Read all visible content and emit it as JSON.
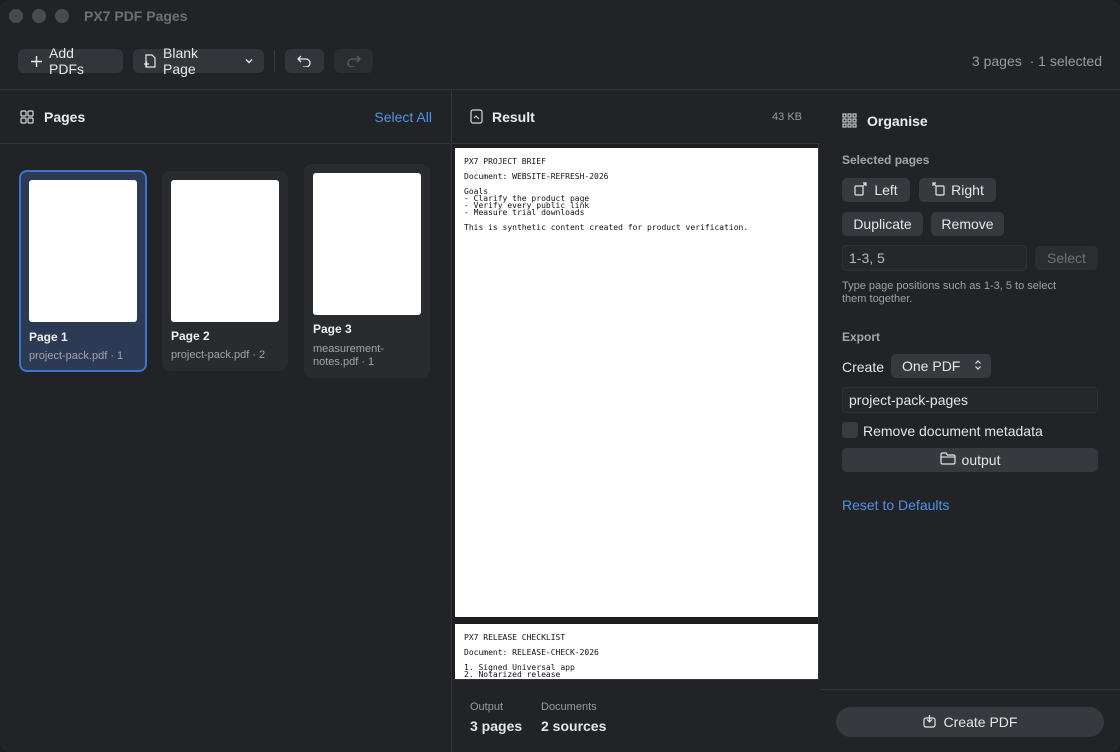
{
  "window": {
    "title": "PX7 PDF Pages"
  },
  "toolbar": {
    "add_pdfs": "Add PDFs",
    "blank_page": "Blank Page",
    "page_count": "3 pages",
    "selected_count": "· 1 selected"
  },
  "pages_panel": {
    "title": "Pages",
    "select_all": "Select All",
    "items": [
      {
        "label": "Page 1",
        "source": "project-pack.pdf · 1",
        "selected": true
      },
      {
        "label": "Page 2",
        "source": "project-pack.pdf · 2",
        "selected": false
      },
      {
        "label": "Page 3",
        "source_line1": "measurement-",
        "source_line2": "notes.pdf · 1",
        "selected": false
      }
    ]
  },
  "result_panel": {
    "title": "Result",
    "size": "43 KB",
    "doc1": {
      "title": "PX7 PROJECT BRIEF",
      "document": "Document: WEBSITE-REFRESH-2026",
      "goals_heading": "Goals",
      "goals": [
        "- Clarify the product page",
        "- Verify every public link",
        "- Measure trial downloads"
      ],
      "note": "This is synthetic content created for product verification."
    },
    "doc2": {
      "title": "PX7 RELEASE CHECKLIST",
      "document": "Document: RELEASE-CHECK-2026",
      "items": [
        "1. Signed Universal app",
        "2. Notarized release"
      ]
    },
    "footer": {
      "output_label": "Output",
      "output_value": "3 pages",
      "documents_label": "Documents",
      "documents_value": "2 sources"
    }
  },
  "organise_panel": {
    "title": "Organise",
    "selected_pages_heading": "Selected pages",
    "left": "Left",
    "right": "Right",
    "duplicate": "Duplicate",
    "remove": "Remove",
    "range_value": "1-3, 5",
    "select": "Select",
    "hint": "Type page positions such as 1-3, 5 to select them together.",
    "export_heading": "Export",
    "create_label": "Create",
    "create_option": "One PDF",
    "filename": "project-pack-pages",
    "remove_metadata": "Remove document metadata",
    "remove_metadata_checked": false,
    "output_folder": "output",
    "reset": "Reset to Defaults",
    "create_pdf": "Create PDF"
  }
}
